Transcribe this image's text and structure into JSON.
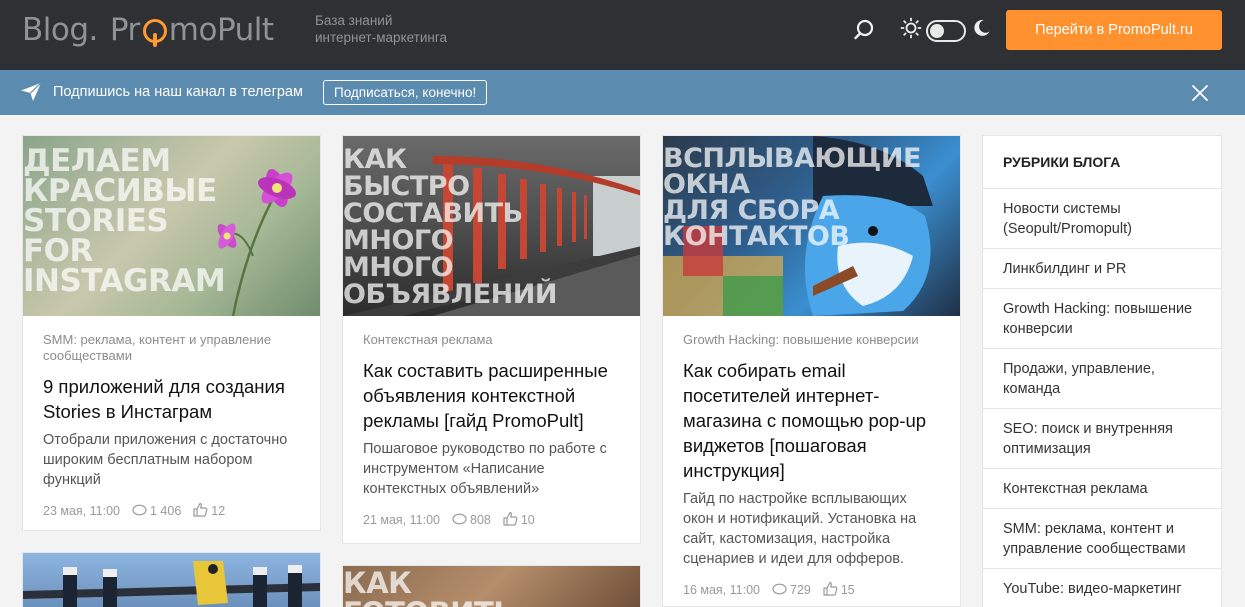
{
  "header": {
    "logo_blog": "Blog.",
    "logo_promo_start": "Pr",
    "logo_promo_end": "moPult",
    "tagline_line1": "База знаний",
    "tagline_line2": "интернет-маркетинга",
    "cta_label": "Перейти в PromoPult.ru"
  },
  "telegram_bar": {
    "text": "Подпишись на наш канал в телеграм",
    "button_label": "Подписаться, конечно!"
  },
  "articles": [
    {
      "image_text": "Делаем\nкрасивые\nStories\nfor\nInstagram",
      "category": "SMM: реклама, контент и управление сообществами",
      "title": "9 приложений для создания Stories в Инстаграм",
      "description": "Отобрали приложения с достаточно широким бесплатным набором функций",
      "date": "23 мая, 11:00",
      "views": "1 406",
      "likes": "12"
    },
    {
      "image_text": "Как\nбыстро\nсоставить\nмного\nмного\nобъявлений",
      "category": "Контекстная реклама",
      "title": "Как составить расширенные объявления контекстной рекламы [гайд PromoPult]",
      "description": "Пошаговое руководство по работе с инструментом «Написание контекстных объявлений»",
      "date": "21 мая, 11:00",
      "views": "808",
      "likes": "10"
    },
    {
      "image_text": "Всплывающие\nокна\nдля сбора\nконтактов",
      "category": "Growth Hacking: повышение конверсии",
      "title": "Как собирать email посетителей интернет-магазина с помощью pop-up виджетов [пошаговая инструкция]",
      "description": "Гайд по настройке всплывающих окон и нотификаций. Установка на сайт, кастомизация, настройка сценариев и идеи для офферов.",
      "date": "16 мая, 11:00",
      "views": "729",
      "likes": "15"
    },
    {
      "image_text": ""
    },
    {
      "image_text": "Как\nготовить"
    }
  ],
  "sidebar": {
    "title": "РУБРИКИ БЛОГА",
    "items": [
      "Новости системы (Seopult/Promopult)",
      "Линкбилдинг и PR",
      "Growth Hacking: повышение конверсии",
      "Продажи, управление, команда",
      "SEO: поиск и внутренняя оптимизация",
      "Контекстная реклама",
      "SMM: реклама, контент и управление сообществами",
      "YouTube: видео-маркетинг"
    ]
  },
  "colors": {
    "header_bg": "#2e3034",
    "accent_orange": "#ff922e",
    "telegram_bar": "#5b8bae"
  }
}
